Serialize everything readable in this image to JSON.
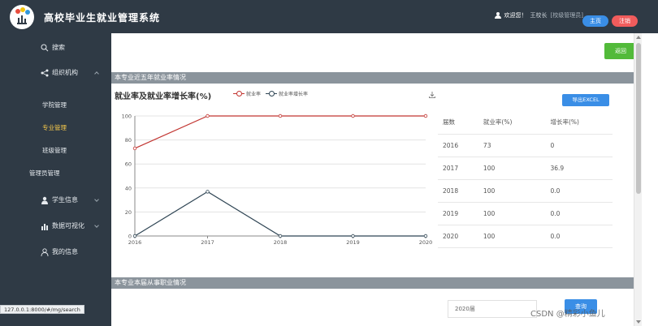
{
  "header": {
    "app_title": "高校毕业生就业管理系统",
    "welcome": "欢迎您！",
    "user_name": "王校长",
    "user_role": "[校级管理员]",
    "home_label": "主页",
    "logout_label": "注销"
  },
  "sidebar": {
    "search": "搜索",
    "org": "组织机构",
    "org_subitems": [
      "学院管理",
      "专业管理",
      "班级管理",
      "管理员管理"
    ],
    "active_subitem": "专业管理",
    "student_info": "学生信息",
    "data_viz": "数据可视化",
    "my_info": "我的信息"
  },
  "status_url": "127.0.0.1:8000/#/mg/search",
  "main": {
    "back_label": "返回",
    "section1_title": "本专业近五年就业率情况",
    "section2_title": "本专业本届从事职业情况",
    "export_label": "导出EXCEL",
    "year_select_value": "2020届",
    "query_label": "查询"
  },
  "table": {
    "headers": [
      "届数",
      "就业率(%)",
      "增长率(%)"
    ],
    "rows": [
      [
        "2016",
        "73",
        "0"
      ],
      [
        "2017",
        "100",
        "36.9"
      ],
      [
        "2018",
        "100",
        "0.0"
      ],
      [
        "2019",
        "100",
        "0.0"
      ],
      [
        "2020",
        "100",
        "0.0"
      ]
    ]
  },
  "chart_data": {
    "type": "line",
    "title": "就业率及就业率增长率(%)",
    "x": [
      "2016",
      "2017",
      "2018",
      "2019",
      "2020"
    ],
    "series": [
      {
        "name": "就业率",
        "values": [
          73,
          100,
          100,
          100,
          100
        ],
        "color": "#c23531"
      },
      {
        "name": "就业率增长率",
        "values": [
          0,
          36.9,
          0,
          0,
          0
        ],
        "color": "#2f4554"
      }
    ],
    "ylim": [
      0,
      100
    ],
    "yticks": [
      0,
      20,
      40,
      60,
      80,
      100
    ],
    "grid": true,
    "legend": "top"
  },
  "colors": {
    "sidebar_bg": "#2f3a45",
    "active_menu": "#f5c84b",
    "back_button": "#52ba3a",
    "primary": "#3a8ee6",
    "danger": "#f05c5c",
    "section_bar": "#8b949c"
  },
  "icons": {
    "search": "search-icon",
    "org": "share-icon",
    "student": "user-icon",
    "data_viz": "bar-chart-icon",
    "my_info": "person-icon",
    "download": "download-icon"
  },
  "watermark": "CSDN @精彩小鱼儿"
}
